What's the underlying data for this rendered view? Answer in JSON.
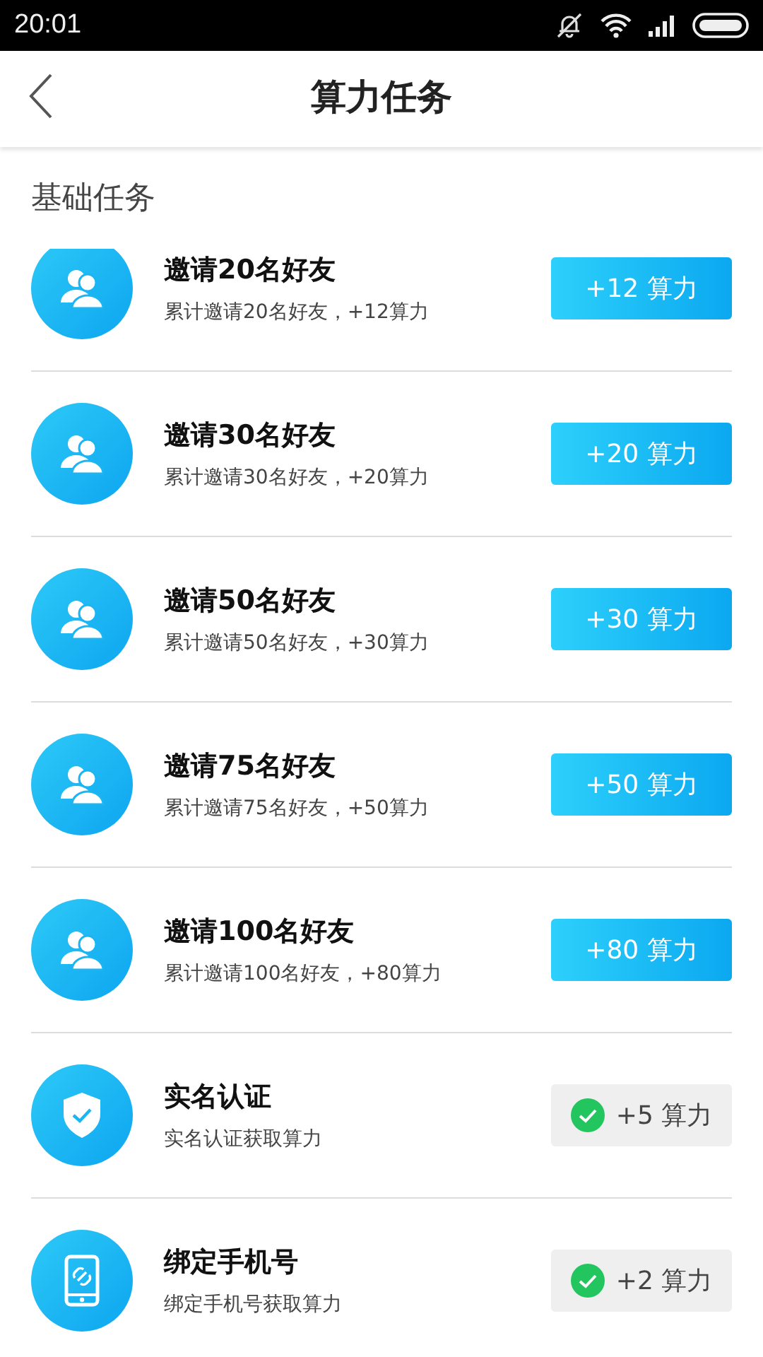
{
  "status_bar": {
    "time": "20:01"
  },
  "header": {
    "title": "算力任务"
  },
  "section": {
    "title": "基础任务"
  },
  "tasks": [
    {
      "kind": "friends",
      "title": "邀请20名好友",
      "subtitle": "累计邀请20名好友，+12算力",
      "reward": "+12 算力",
      "completed": false
    },
    {
      "kind": "friends",
      "title": "邀请30名好友",
      "subtitle": "累计邀请30名好友，+20算力",
      "reward": "+20 算力",
      "completed": false
    },
    {
      "kind": "friends",
      "title": "邀请50名好友",
      "subtitle": "累计邀请50名好友，+30算力",
      "reward": "+30 算力",
      "completed": false
    },
    {
      "kind": "friends",
      "title": "邀请75名好友",
      "subtitle": "累计邀请75名好友，+50算力",
      "reward": "+50 算力",
      "completed": false
    },
    {
      "kind": "friends",
      "title": "邀请100名好友",
      "subtitle": "累计邀请100名好友，+80算力",
      "reward": "+80 算力",
      "completed": false
    },
    {
      "kind": "verify",
      "title": "实名认证",
      "subtitle": "实名认证获取算力",
      "reward": "+5 算力",
      "completed": true
    },
    {
      "kind": "phone",
      "title": "绑定手机号",
      "subtitle": "绑定手机号获取算力",
      "reward": "+2 算力",
      "completed": true
    }
  ]
}
